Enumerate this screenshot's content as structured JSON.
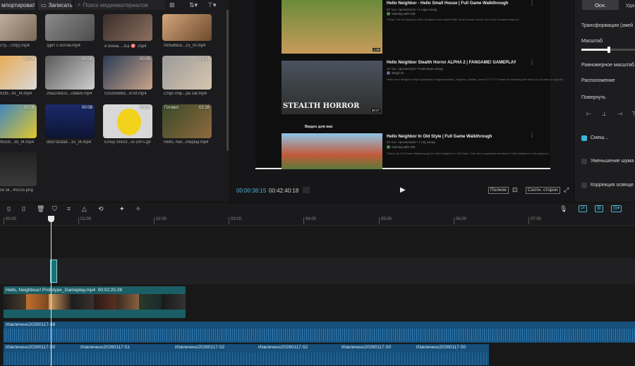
{
  "media": {
    "import_label": "мпортировать",
    "record_label": "Записать",
    "search_placeholder": "Поиск медиаматериалов",
    "items": [
      {
        "caption": "сту...720p).mp4",
        "duration": ""
      },
      {
        "caption": "здит с котом.mp4",
        "duration": ""
      },
      {
        "caption": "я очень ...ica 🎯 .mp4",
        "duration": ""
      },
      {
        "caption": "0fc6afbce...15_t4.mp4",
        "duration": ""
      },
      {
        "caption": "91fb...41_t4.mp4",
        "duration": "00:04"
      },
      {
        "caption": "26a10ed2c...c8ae8.mp4",
        "duration": "00:08"
      },
      {
        "caption": "5153c6ebd...d7ef.mp4",
        "duration": "00:05"
      },
      {
        "caption": "Chipi chip...pa cat.mp4",
        "duration": "00:14"
      },
      {
        "caption": "f63c8...35_t4.mp4",
        "duration": "00:08"
      },
      {
        "caption": "dbd7dcda8...15_t4.mp4",
        "duration": "00:08"
      },
      {
        "caption": "Emoji Shoot...re GIFs.gif",
        "duration": "00:05"
      },
      {
        "caption": "Hello, Nei...meplay.mp4",
        "duration": "02:26",
        "badge": "Готово!"
      },
      {
        "caption": "ок эк...45155.png",
        "duration": ""
      }
    ]
  },
  "preview": {
    "current_time": "00:00:38:15",
    "total_time": "00:42:40:18",
    "fullscreen_label": "Полное",
    "ratio_label": "Соотн. сторон",
    "videos": [
      {
        "title": "Hello Neighbor - Hello Small House | Full Game Walkthrough",
        "meta": "53 тыс. просмотров • 3 года назад",
        "channel": "Gaming with GM",
        "desc": "Today I will be playing a Hello Neighbor mod called Hello Small House and its one of the smallest maps to...",
        "duration": "4:39"
      },
      {
        "title": "Hello Neighbor Stealth Horror ALPHA 2 | FANGAME! GAMEPLAY",
        "meta": "12 тыс. просмотров • 5 месяцев назад",
        "channel": "Sergii Sl",
        "desc": "Hello new! Neighbor https://gamejolt.com/games/hello_neighbor_stealth_horror/777177 Thanks for watching the video! If you want to support...",
        "duration": "38:27",
        "overlay": "STEALTH HORROR"
      },
      {
        "title": "Hello Neighbor In Old Style | Full Game Walkthrough",
        "meta": "53 тыс. просмотров • 1 год назад",
        "channel": "Gaming with GM",
        "desc": "This is my Full Game Walkthrough for Hello Neighbor in Old Style. This mod completely transforms Hello Neighbor to the alpha-st...",
        "duration": ""
      }
    ],
    "section_label": "Видео для вас"
  },
  "inspector": {
    "tabs": [
      "Осн.",
      "Уда"
    ],
    "labels": {
      "transform": "Трансформация (змей",
      "scale": "Масштаб",
      "uniform": "Равномерное масштаб",
      "position": "Расположение",
      "rotate": "Повернуть",
      "blend": "Смеш...",
      "denoise": "Уменьшение шума",
      "light": "Коррекция освеще"
    },
    "scale_value_fraction": 0.5
  },
  "timeline": {
    "ruler": [
      "00:00",
      "01:00",
      "02:00",
      "03:00",
      "04:00",
      "05:00",
      "06:00",
      "07:00"
    ],
    "video_clip_label": "Hello, Neighbour! Prototype_Gameplay.mp4",
    "video_clip_duration": "00:02:25:28",
    "audio_top": "Извлечено20260117-48",
    "audio_segments": [
      "Извлечено20260117-50",
      "Извлечено20260117-51",
      "Извлечено20260117-52",
      "Извлечено20260117-52",
      "Извлечено20260117-50",
      "Извлечено20260117-50"
    ]
  },
  "colors": {
    "accent": "#4bb6d6",
    "video_clip": "#1a5e66",
    "audio_clip": "#164f7a"
  }
}
